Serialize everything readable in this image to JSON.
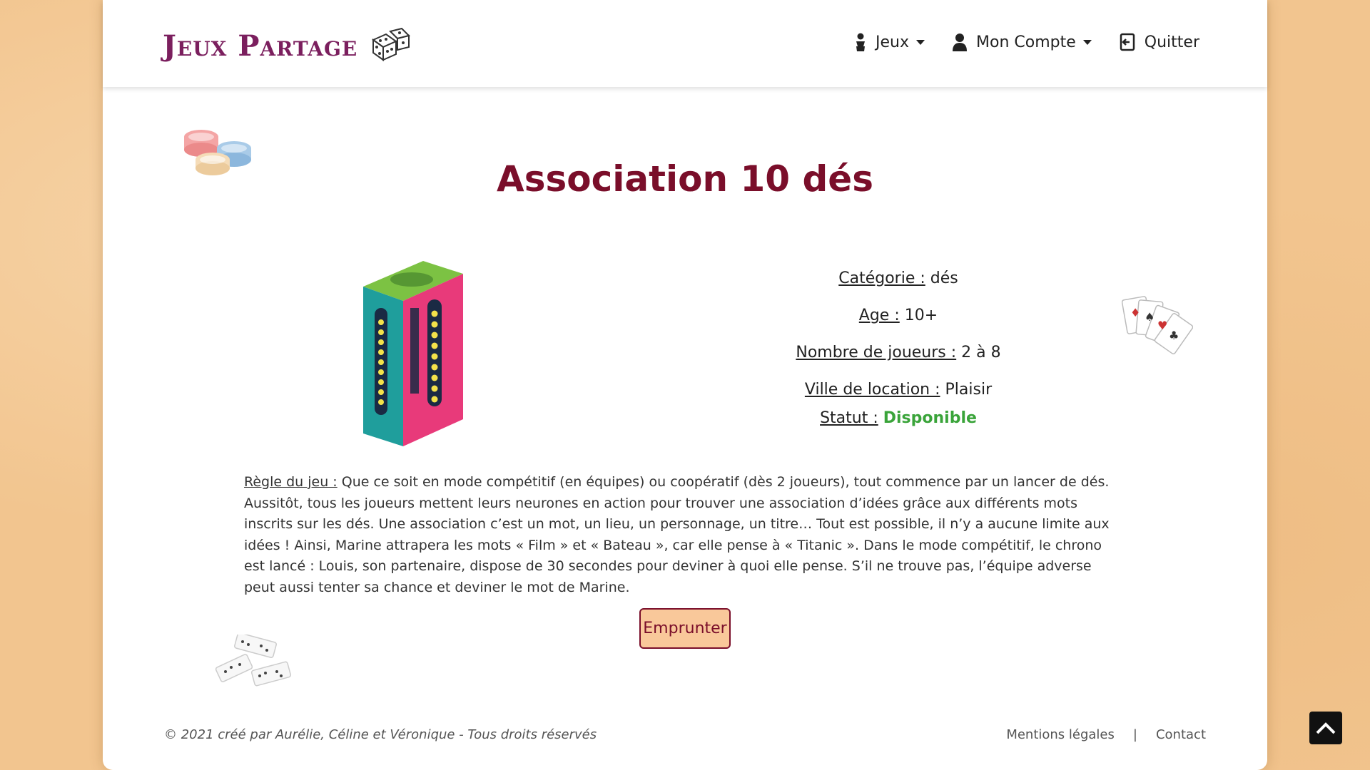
{
  "brand": {
    "logo_text": "Jeux Partage"
  },
  "nav": {
    "games_label": "Jeux",
    "account_label": "Mon Compte",
    "logout_label": "Quitter"
  },
  "game": {
    "title": "Association 10 dés",
    "category_label": "Catégorie :",
    "category_value": "dés",
    "age_label": "Age :",
    "age_value": "10+",
    "players_label": "Nombre de joueurs :",
    "players_value": "2 à 8",
    "city_label": "Ville de location :",
    "city_value": "Plaisir",
    "status_label": "Statut :",
    "status_value": "Disponible",
    "rules_label": "Règle du jeu :",
    "rules_text": "Que ce soit en mode compétitif (en équipes) ou coopératif (dès 2 joueurs), tout commence par un lancer de dés. Aussitôt, tous les joueurs mettent leurs neurones en action pour trouver une association d’idées grâce aux différents mots inscrits sur les dés. Une association c’est un mot, un lieu, un personnage, un titre… Tout est possible, il n’y a aucune limite aux idées ! Ainsi, Marine attrapera les mots « Film » et « Bateau », car elle pense à « Titanic ». Dans le mode compétitif, le chrono est lancé : Louis, son partenaire, dispose de 30 secondes pour deviner à quoi elle pense. S’il ne trouve pas, l’équipe adverse peut aussi tenter sa chance et deviner le mot de Marine.",
    "borrow_label": "Emprunter"
  },
  "footer": {
    "copyright": "© 2021 créé par Aurélie, Céline et Véronique - Tous droits réservés",
    "legal_label": "Mentions légales",
    "separator": "|",
    "contact_label": "Contact"
  },
  "colors": {
    "title": "#7a0e2a",
    "logo": "#7b1f5e",
    "status": "#3aa43a",
    "button_bg": "#f9c89a",
    "page_bg": "#f2c58f"
  },
  "icons": {
    "games": "user-icon",
    "account": "user-icon",
    "logout": "sign-out-icon",
    "back_to_top": "chevron-up-icon"
  }
}
